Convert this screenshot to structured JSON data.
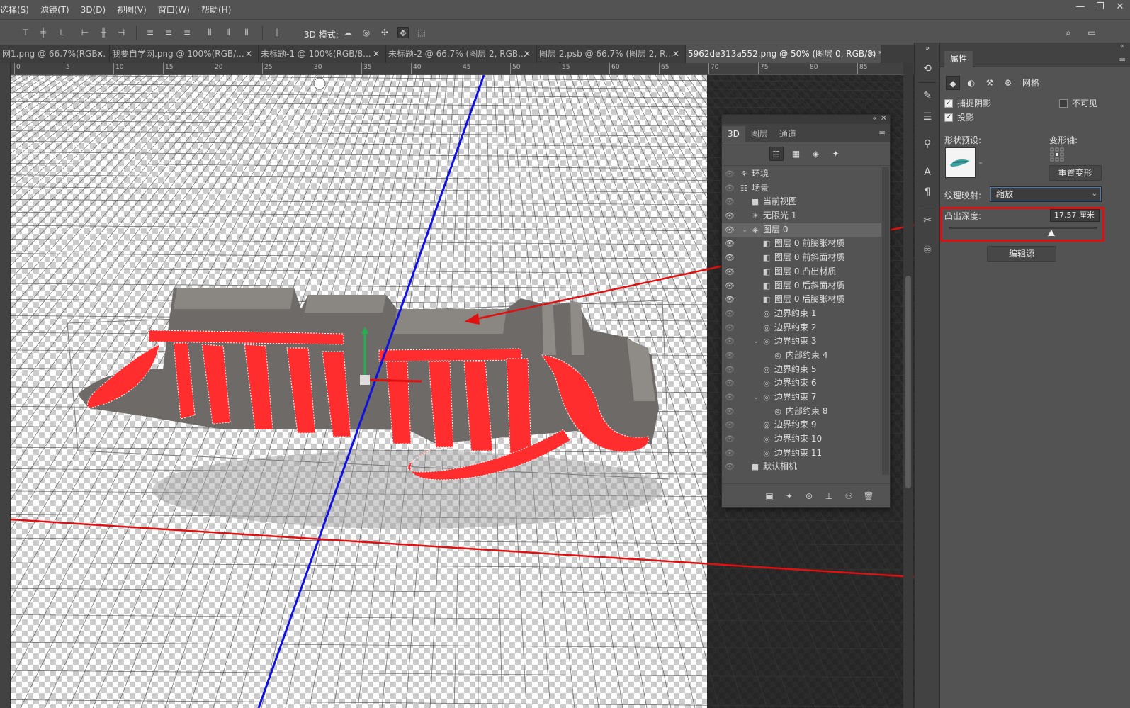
{
  "menu": [
    "选择(S)",
    "滤镜(T)",
    "3D(D)",
    "视图(V)",
    "窗口(W)",
    "帮助(H)"
  ],
  "window_controls": [
    "—",
    "❐",
    "✕"
  ],
  "options_bar": {
    "mode_label": "3D 模式:"
  },
  "tabs": [
    {
      "label": "网1.png @ 66.7%(RGB..."
    },
    {
      "label": "我要自学网.png @ 100%(RGB/..."
    },
    {
      "label": "未标题-1 @ 100%(RGB/8..."
    },
    {
      "label": "未标题-2 @ 66.7% (图层 2, RGB..."
    },
    {
      "label": "图层 2.psb @ 66.7% (图层 2, R..."
    },
    {
      "label": "5962de313a552.png @ 50% (图层 0, RGB/8) *"
    }
  ],
  "ruler_ticks": [
    "0",
    "5",
    "10",
    "15",
    "20",
    "25",
    "30",
    "35",
    "40",
    "45",
    "50",
    "55",
    "60",
    "65",
    "70",
    "75",
    "80",
    "85"
  ],
  "panel3d": {
    "tabs": [
      "3D",
      "图层",
      "通道"
    ],
    "rows": [
      {
        "label": "环境",
        "visible": false
      },
      {
        "label": "场景",
        "visible": false
      },
      {
        "label": "当前视图",
        "visible": false
      },
      {
        "label": "无限光 1",
        "visible": true
      },
      {
        "label": "图层 0",
        "visible": true
      },
      {
        "label": "图层 0 前膨胀材质",
        "visible": true
      },
      {
        "label": "图层 0 前斜面材质",
        "visible": true
      },
      {
        "label": "图层 0 凸出材质",
        "visible": true
      },
      {
        "label": "图层 0 后斜面材质",
        "visible": true
      },
      {
        "label": "图层 0 后膨胀材质",
        "visible": true
      },
      {
        "label": "边界约束 1",
        "visible": false
      },
      {
        "label": "边界约束 2",
        "visible": false
      },
      {
        "label": "边界约束 3",
        "visible": false
      },
      {
        "label": "内部约束 4",
        "visible": false
      },
      {
        "label": "边界约束 5",
        "visible": false
      },
      {
        "label": "边界约束 6",
        "visible": false
      },
      {
        "label": "边界约束 7",
        "visible": false
      },
      {
        "label": "内部约束 8",
        "visible": false
      },
      {
        "label": "边界约束 9",
        "visible": false
      },
      {
        "label": "边界约束 10",
        "visible": false
      },
      {
        "label": "边界约束 11",
        "visible": false
      },
      {
        "label": "默认相机",
        "visible": false
      }
    ]
  },
  "properties": {
    "title": "属性",
    "mesh_label": "网格",
    "catch_shadow": "捕捉阴影",
    "invisible": "不可见",
    "cast_shadow": "投影",
    "shape_preset": "形状预设:",
    "deform_axis": "变形轴:",
    "reset_deform": "重置变形",
    "texture_mapping": "纹理映射:",
    "texture_value": "缩放",
    "extrusion_depth": "凸出深度:",
    "depth_value": "17.57 厘米",
    "depth_fraction": 0.69,
    "edit_source": "编辑源"
  },
  "colors": {
    "text_red": "#ff2d2d",
    "annotation_red": "#e01010",
    "axis_blue": "#1010e0"
  }
}
